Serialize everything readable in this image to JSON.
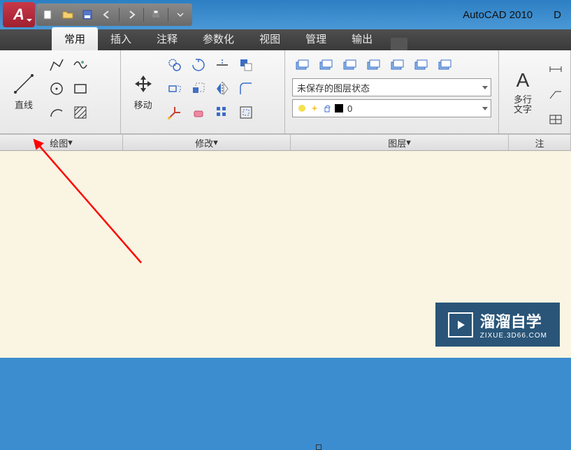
{
  "titlebar": {
    "app_initial": "A",
    "title": "AutoCAD 2010",
    "doc": "D"
  },
  "ribbon_tabs": [
    {
      "label": "常用",
      "active": true
    },
    {
      "label": "插入",
      "active": false
    },
    {
      "label": "注释",
      "active": false
    },
    {
      "label": "参数化",
      "active": false
    },
    {
      "label": "视图",
      "active": false
    },
    {
      "label": "管理",
      "active": false
    },
    {
      "label": "输出",
      "active": false
    }
  ],
  "panels": {
    "draw": {
      "label": "直线",
      "group_label": "绘图"
    },
    "modify": {
      "label": "移动",
      "group_label": "修改"
    },
    "layer": {
      "group_label": "图层",
      "state_text": "未保存的图层状态",
      "layer_number": "0"
    },
    "annotate": {
      "label": "多行\n文字",
      "group_label": "注"
    }
  },
  "watermark": {
    "main": "溜溜自学",
    "sub": "ZIXUE.3D66.COM"
  }
}
